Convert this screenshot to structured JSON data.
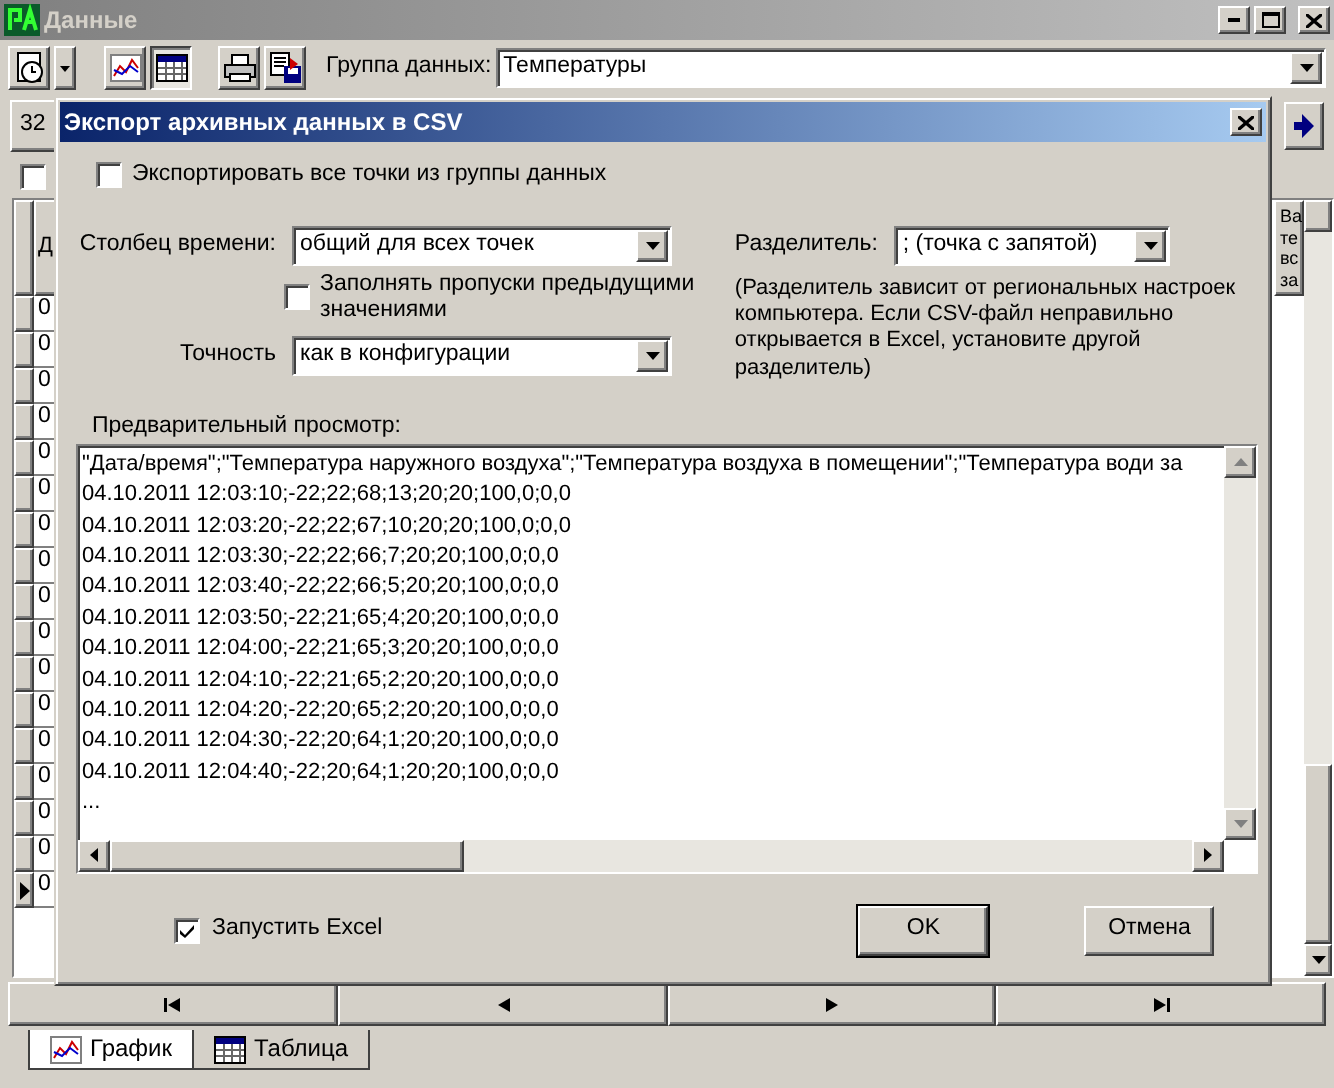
{
  "window": {
    "title": "Данные"
  },
  "toolbar": {
    "view_buttons": [
      {
        "kind": "chart",
        "selected": false
      },
      {
        "kind": "table",
        "selected": true
      }
    ],
    "group_label": "Группа данных:",
    "group_value": "Температуры"
  },
  "period_field": "32",
  "filter_checkbox": {
    "checked": false
  },
  "grid": {
    "first_column_header": "Д",
    "last_column_header": [
      "Ва",
      "те",
      "вс",
      "за"
    ],
    "rows": [
      {
        "cell": "0",
        "current": false
      },
      {
        "cell": "0",
        "current": false
      },
      {
        "cell": "0",
        "current": false
      },
      {
        "cell": "0",
        "current": false
      },
      {
        "cell": "0",
        "current": false
      },
      {
        "cell": "0",
        "current": false
      },
      {
        "cell": "0",
        "current": false
      },
      {
        "cell": "0",
        "current": false
      },
      {
        "cell": "0",
        "current": false
      },
      {
        "cell": "0",
        "current": false
      },
      {
        "cell": "0",
        "current": false
      },
      {
        "cell": "0",
        "current": false
      },
      {
        "cell": "0",
        "current": false
      },
      {
        "cell": "0",
        "current": false
      },
      {
        "cell": "0",
        "current": false
      },
      {
        "cell": "0",
        "current": false
      },
      {
        "cell": "0",
        "current": true
      }
    ]
  },
  "tabs": [
    {
      "label": "График",
      "kind": "chart",
      "selected": true
    },
    {
      "label": "Таблица",
      "kind": "table",
      "selected": false
    }
  ],
  "dialog": {
    "title": "Экспорт архивных данных в CSV",
    "export_all": {
      "label": "Экспортировать все точки из группы данных",
      "checked": false
    },
    "time_column": {
      "label": "Столбец времени:",
      "value": "общий для всех точек"
    },
    "fill_gaps": {
      "label": "Заполнять пропуски предыдущими значениями",
      "checked": false
    },
    "precision": {
      "label": "Точность",
      "value": "как в конфигурации"
    },
    "separator": {
      "label": "Разделитель:",
      "value": "; (точка с запятой)"
    },
    "separator_note": "(Разделитель зависит от региональных настроек компьютера. Если CSV-файл неправильно открывается в Excel, установите другой разделитель)",
    "preview_label": "Предварительный просмотр:",
    "preview_lines": [
      "\"Дата/время\";\"Температура наружного воздуха\";\"Температура воздуха в помещении\";\"Температура води за",
      "04.10.2011 12:03:10;-22;22;68;13;20;20;100,0;0,0",
      "04.10.2011 12:03:20;-22;22;67;10;20;20;100,0;0,0",
      "04.10.2011 12:03:30;-22;22;66;7;20;20;100,0;0,0",
      "04.10.2011 12:03:40;-22;22;66;5;20;20;100,0;0,0",
      "04.10.2011 12:03:50;-22;21;65;4;20;20;100,0;0,0",
      "04.10.2011 12:04:00;-22;21;65;3;20;20;100,0;0,0",
      "04.10.2011 12:04:10;-22;21;65;2;20;20;100,0;0,0",
      "04.10.2011 12:04:20;-22;20;65;2;20;20;100,0;0,0",
      "04.10.2011 12:04:30;-22;20;64;1;20;20;100,0;0,0",
      "04.10.2011 12:04:40;-22;20;64;1;20;20;100,0;0,0",
      "..."
    ],
    "run_excel": {
      "label": "Запустить Excel",
      "checked": true
    },
    "buttons": [
      {
        "label": "OK",
        "kind": "default"
      },
      {
        "label": "Отмена",
        "kind": "normal"
      }
    ]
  }
}
